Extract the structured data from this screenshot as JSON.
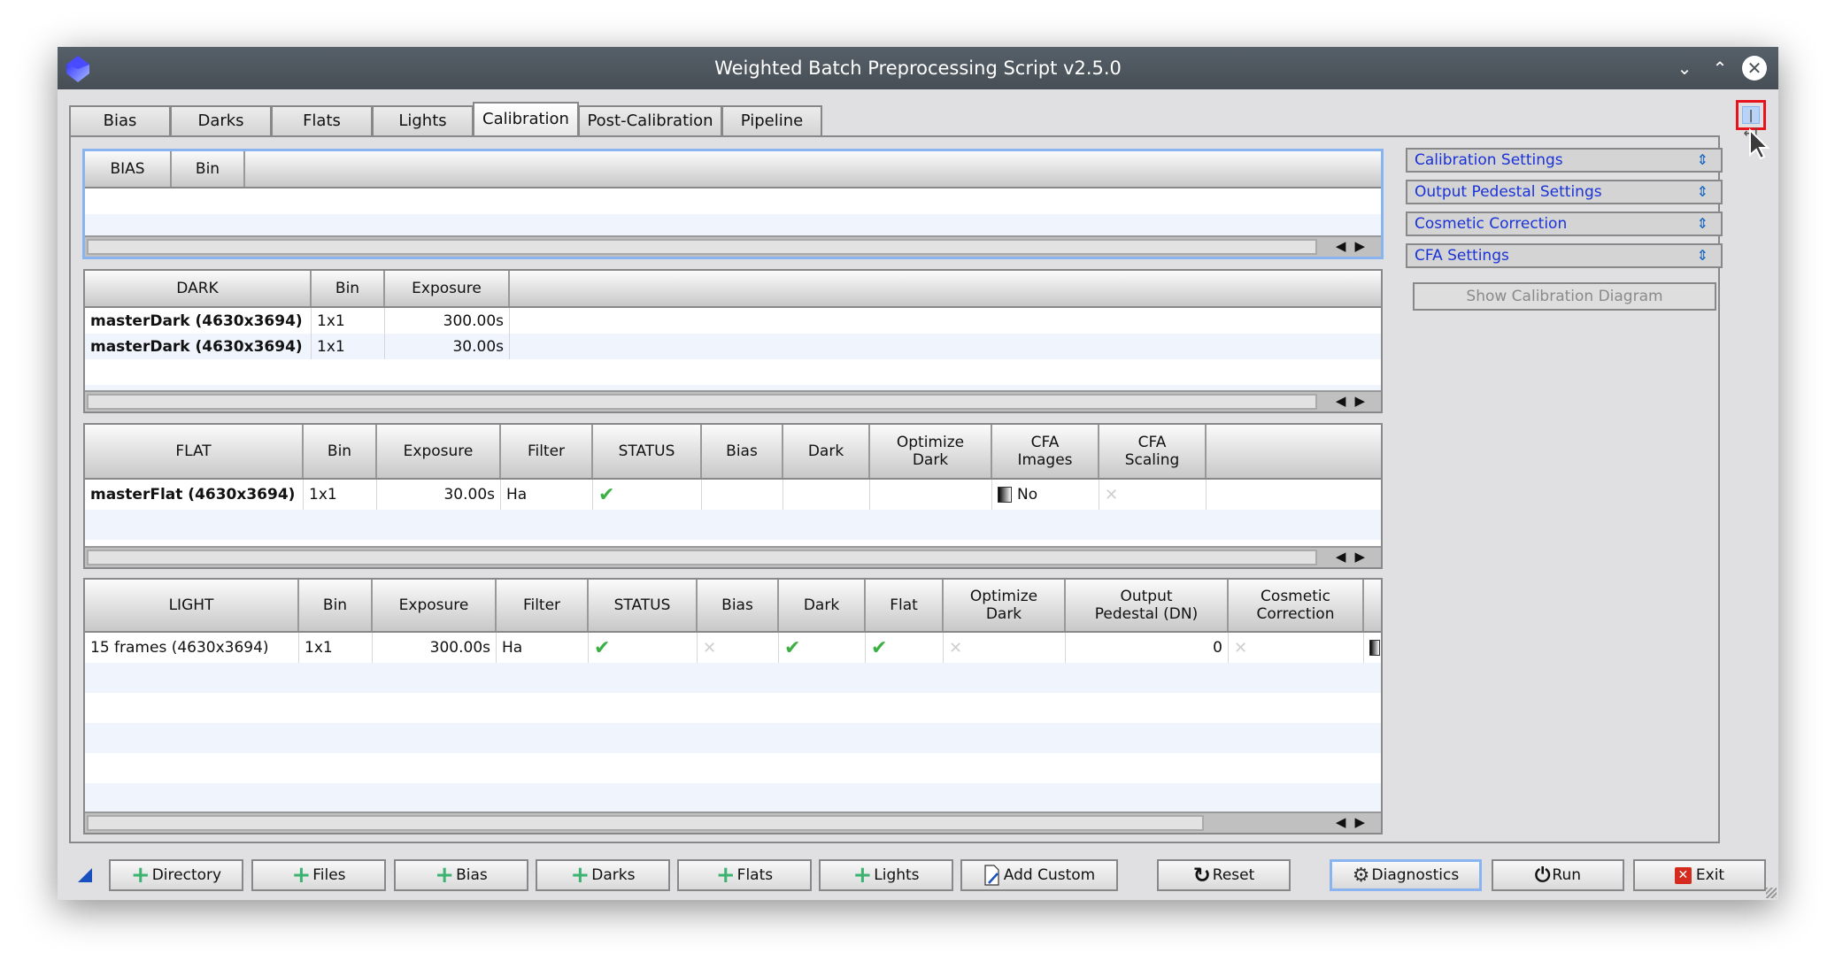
{
  "window": {
    "title": "Weighted Batch Preprocessing Script v2.5.0",
    "controls": {
      "minimize": "⌄",
      "maximize": "⌃",
      "close": "✕"
    }
  },
  "tabs": [
    {
      "label": "Bias"
    },
    {
      "label": "Darks"
    },
    {
      "label": "Flats"
    },
    {
      "label": "Lights"
    },
    {
      "label": "Calibration",
      "active": true
    },
    {
      "label": "Post-Calibration"
    },
    {
      "label": "Pipeline"
    }
  ],
  "bias_table": {
    "headers": [
      "BIAS",
      "Bin"
    ],
    "rows": []
  },
  "dark_table": {
    "headers": [
      "DARK",
      "Bin",
      "Exposure"
    ],
    "rows": [
      {
        "name": "masterDark (4630x3694)",
        "bin": "1x1",
        "exposure": "300.00s"
      },
      {
        "name": "masterDark (4630x3694)",
        "bin": "1x1",
        "exposure": "30.00s"
      }
    ]
  },
  "flat_table": {
    "headers": [
      "FLAT",
      "Bin",
      "Exposure",
      "Filter",
      "STATUS",
      "Bias",
      "Dark",
      "Optimize\nDark",
      "CFA\nImages",
      "CFA\nScaling"
    ],
    "rows": [
      {
        "name": "masterFlat (4630x3694)",
        "bin": "1x1",
        "exposure": "30.00s",
        "filter": "Ha",
        "status": "check",
        "bias": "",
        "dark": "",
        "optimize_dark": "",
        "cfa_images": "No",
        "cfa_scaling": "x"
      }
    ]
  },
  "light_table": {
    "headers": [
      "LIGHT",
      "Bin",
      "Exposure",
      "Filter",
      "STATUS",
      "Bias",
      "Dark",
      "Flat",
      "Optimize\nDark",
      "Output\nPedestal (DN)",
      "Cosmetic\nCorrection"
    ],
    "rows": [
      {
        "name": "15 frames (4630x3694)",
        "bin": "1x1",
        "exposure": "300.00s",
        "filter": "Ha",
        "status": "check",
        "bias": "x",
        "dark": "check",
        "flat": "check",
        "optimize_dark": "x",
        "output_pedestal": "0",
        "cosmetic_correction": "x"
      }
    ]
  },
  "side_panel": {
    "sections": [
      {
        "label": "Calibration Settings"
      },
      {
        "label": "Output Pedestal Settings"
      },
      {
        "label": "Cosmetic Correction"
      },
      {
        "label": "CFA Settings"
      }
    ],
    "diagram_button": "Show Calibration Diagram"
  },
  "bottom_buttons": {
    "directory": "Directory",
    "files": "Files",
    "bias": "Bias",
    "darks": "Darks",
    "flats": "Flats",
    "lights": "Lights",
    "add_custom": "Add Custom",
    "reset": "Reset",
    "diagnostics": "Diagnostics",
    "run": "Run",
    "exit": "Exit"
  },
  "glyphs": {
    "check": "✔",
    "x": "✕",
    "plus": "+",
    "scroll_arrows": "◀▶",
    "collapse": "⇕",
    "expand": "|↔|"
  },
  "colors": {
    "check": "#3cb043",
    "link": "#1a32d8",
    "focus": "#8ab4f0",
    "highlight": "#e8141c",
    "exit": "#d42b1e"
  }
}
